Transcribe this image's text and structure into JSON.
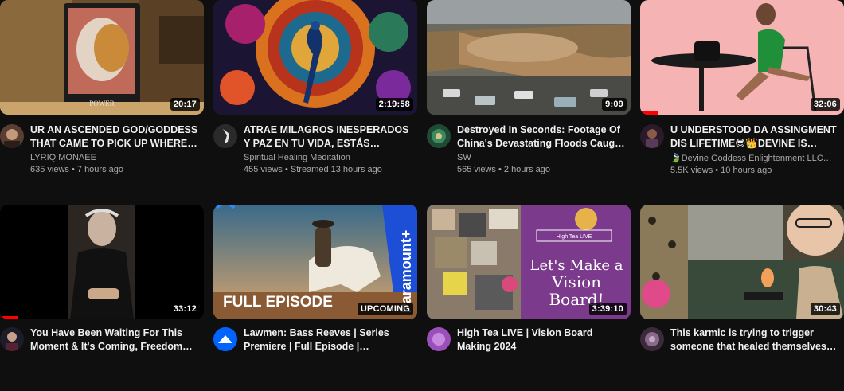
{
  "videos": [
    {
      "title_line1": "UR AN ASCENDED GOD/GODDESS",
      "title_line2": "THAT CAME TO PICK UP WHERE…",
      "channel": "LYRIQ MONAEE",
      "views": "635 views",
      "age": "7 hours ago",
      "duration": "20:17",
      "thumb_text": "POWER"
    },
    {
      "title_line1": "ATRAE MILAGROS INESPERADOS",
      "title_line2": "Y PAZ EN TU VIDA, ESTÁS…",
      "channel": "Spiritual Healing Meditation",
      "views": "455 views",
      "age": "Streamed 13 hours ago",
      "duration": "2:19:58"
    },
    {
      "title_line1": "Destroyed In Seconds: Footage Of",
      "title_line2": "China's Devastating Floods Caug…",
      "channel": "SW",
      "views": "565 views",
      "age": "2 hours ago",
      "duration": "9:09"
    },
    {
      "title_line1": "U UNDERSTOOD DA ASSINGMENT",
      "title_line2": "DIS LIFETIME😎👑DEVINE IS…",
      "channel": "🍃Devine Goddess Enlightenment LLC…",
      "views": "5.5K views",
      "age": "10 hours ago",
      "duration": "32:06",
      "progress": 0.09
    },
    {
      "title_line1": "You Have Been Waiting For This",
      "title_line2": "Moment & It's Coming, Freedom…",
      "duration": "33:12",
      "progress": 0.09
    },
    {
      "title_line1": "Lawmen: Bass Reeves | Series",
      "title_line2": "Premiere | Full Episode |…",
      "duration": "UPCOMING",
      "thumb_text": "FULL EPISODE",
      "brand_text": "Paramount+"
    },
    {
      "title_line1": "High Tea LIVE | Vision Board",
      "title_line2": "Making 2024",
      "duration": "3:39:10",
      "thumb_text_1": "Let's Make a",
      "thumb_text_2": "Vision",
      "thumb_text_3": "Board!",
      "thumb_label": "High Tea LIVE"
    },
    {
      "title_line1": "This karmic is trying to trigger",
      "title_line2": "someone that healed themselves…",
      "duration": "30:43"
    }
  ],
  "colors": {
    "background": "#0f0f0f",
    "progress": "#ff0000",
    "title": "#f1f1f1",
    "secondary": "#aaaaaa"
  }
}
